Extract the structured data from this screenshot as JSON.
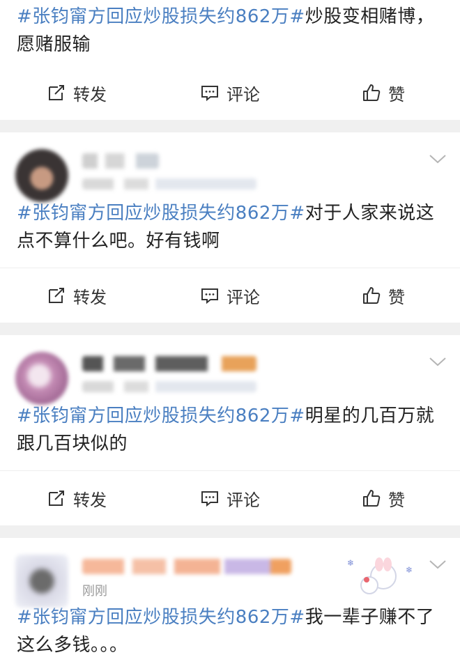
{
  "posts": [
    {
      "content": {
        "hashtag": "#张钧甯方回应炒股损失约862万#",
        "text": "炒股变相赌博，愿赌服输"
      },
      "actions": {
        "repost": "转发",
        "comment": "评论",
        "like": "赞"
      }
    },
    {
      "content": {
        "hashtag": "#张钧甯方回应炒股损失约862万#",
        "text": "对于人家来说这点不算什么吧。好有钱啊"
      },
      "actions": {
        "repost": "转发",
        "comment": "评论",
        "like": "赞"
      }
    },
    {
      "content": {
        "hashtag": "#张钧甯方回应炒股损失约862万#",
        "text": "明星的几百万就跟几百块似的"
      },
      "actions": {
        "repost": "转发",
        "comment": "评论",
        "like": "赞"
      }
    },
    {
      "meta_time": "刚刚",
      "content": {
        "hashtag": "#张钧甯方回应炒股损失约862万#",
        "text": "我一辈子赚不了这么多钱。。。"
      }
    }
  ],
  "colors": {
    "hashtag": "#4a7fc1",
    "separator": "#f0f0f0",
    "text": "#222222"
  }
}
